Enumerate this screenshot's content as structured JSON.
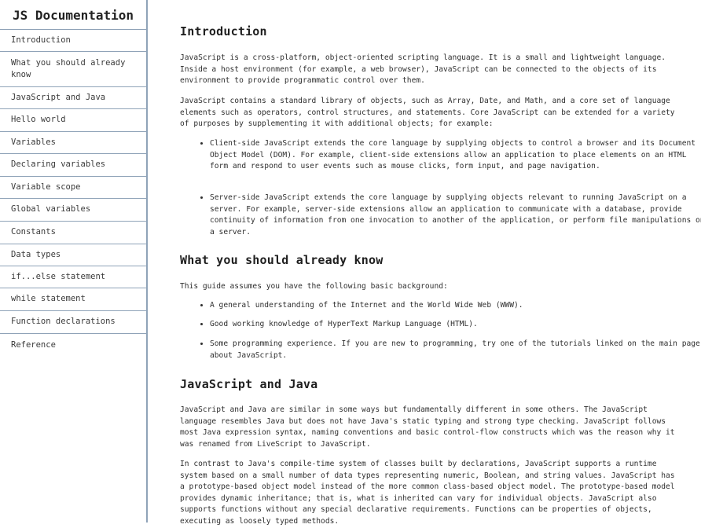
{
  "sidebar": {
    "title": "JS Documentation",
    "items": [
      {
        "label": "Introduction"
      },
      {
        "label": "What you should already know"
      },
      {
        "label": "JavaScript and Java"
      },
      {
        "label": "Hello world"
      },
      {
        "label": "Variables"
      },
      {
        "label": "Declaring variables"
      },
      {
        "label": "Variable scope"
      },
      {
        "label": "Global variables"
      },
      {
        "label": "Constants"
      },
      {
        "label": "Data types"
      },
      {
        "label": "if...else statement"
      },
      {
        "label": "while statement"
      },
      {
        "label": "Function declarations"
      },
      {
        "label": "Reference"
      }
    ]
  },
  "sections": {
    "introduction": {
      "title": "Introduction",
      "p1": "JavaScript is a cross-platform, object-oriented scripting language. It is a small and lightweight language. Inside a host environment (for example, a web browser), JavaScript can be connected to the objects of its environment to provide programmatic control over them.",
      "p2": "JavaScript contains a standard library of objects, such as Array, Date, and Math, and a core set of language elements such as operators, control structures, and statements. Core JavaScript can be extended for a variety of purposes by supplementing it with additional objects; for example:",
      "bullets": [
        "Client-side JavaScript extends the core language by supplying objects to control a browser and its Document Object Model (DOM). For example, client-side extensions allow an application to place elements on an HTML form and respond to user events such as mouse clicks, form input, and page navigation.",
        "Server-side JavaScript extends the core language by supplying objects relevant to running JavaScript on a server. For example, server-side extensions allow an application to communicate with a database, provide continuity of information from one invocation to another of the application, or perform file manipulations on a server."
      ]
    },
    "what_you_should_know": {
      "title": "What you should already know",
      "p1": "This guide assumes you have the following basic background:",
      "bullets": [
        "A general understanding of the Internet and the World Wide Web (WWW).",
        "Good working knowledge of HyperText Markup Language (HTML).",
        "Some programming experience. If you are new to programming, try one of the tutorials linked on the main page about JavaScript."
      ]
    },
    "javascript_and_java": {
      "title": "JavaScript and Java",
      "p1": "JavaScript and Java are similar in some ways but fundamentally different in some others. The JavaScript language resembles Java but does not have Java's static typing and strong type checking. JavaScript follows most Java expression syntax, naming conventions and basic control-flow constructs which was the reason why it was renamed from LiveScript to JavaScript.",
      "p2": "In contrast to Java's compile-time system of classes built by declarations, JavaScript supports a runtime system based on a small number of data types representing numeric, Boolean, and string values. JavaScript has a prototype-based object model instead of the more common class-based object model. The prototype-based model provides dynamic inheritance; that is, what is inherited can vary for individual objects. JavaScript also supports functions without any special declarative requirements. Functions can be properties of objects, executing as loosely typed methods."
    }
  }
}
